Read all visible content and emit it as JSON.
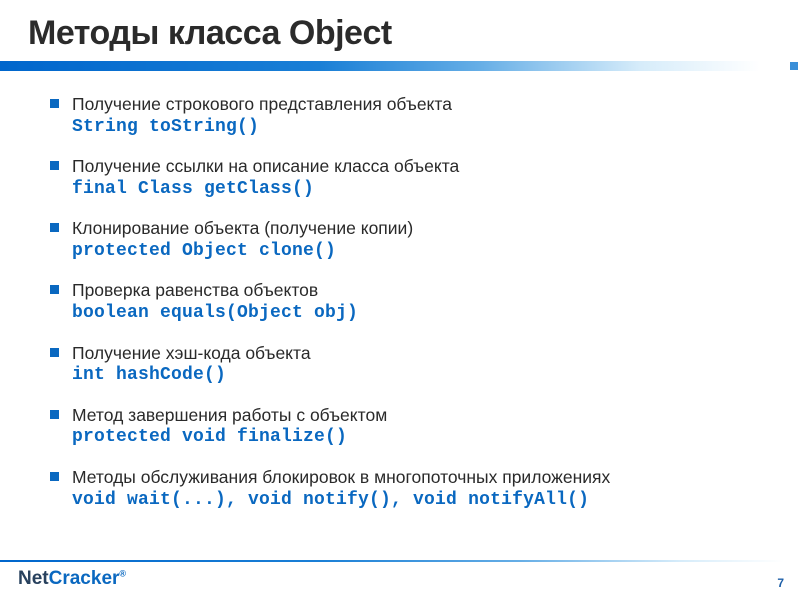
{
  "title": "Методы класса Object",
  "bullets": [
    {
      "desc": "Получение строкового представления объекта",
      "code": "String toString()"
    },
    {
      "desc": "Получение ссылки на описание класса объекта",
      "code": "final Class getClass()"
    },
    {
      "desc": "Клонирование объекта (получение копии)",
      "code": "protected Object clone()"
    },
    {
      "desc": "Проверка равенства объектов",
      "code": "boolean equals(Object obj)"
    },
    {
      "desc": "Получение хэш-кода объекта",
      "code": "int hashCode()"
    },
    {
      "desc": "Метод завершения работы с объектом",
      "code": "protected void finalize()"
    },
    {
      "desc": "Методы обслуживания блокировок в многопоточных приложениях",
      "code": "void wait(...), void notify(), void notifyAll()"
    }
  ],
  "footer": {
    "logo_part1": "Net",
    "logo_part2": "Cracker",
    "logo_mark": "®",
    "page": "7"
  }
}
